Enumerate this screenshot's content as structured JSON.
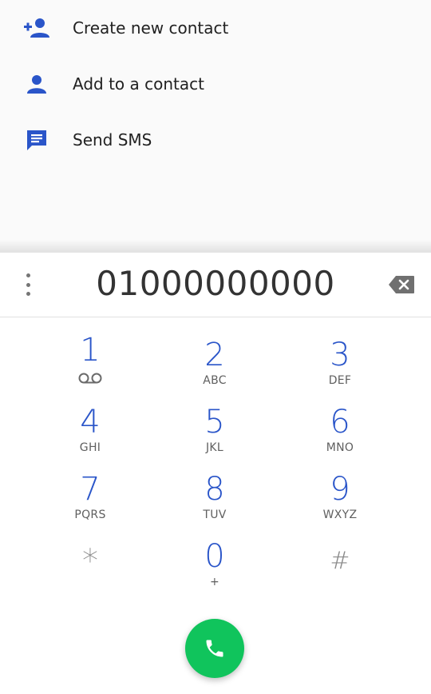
{
  "suggestions": [
    {
      "label": "Create new contact",
      "icon": "person-add-icon"
    },
    {
      "label": "Add to a contact",
      "icon": "person-icon"
    },
    {
      "label": "Send SMS",
      "icon": "message-icon"
    }
  ],
  "dialer": {
    "number": "01000000000",
    "keys": [
      {
        "digit": "1",
        "letters": "",
        "voicemail": true
      },
      {
        "digit": "2",
        "letters": "ABC"
      },
      {
        "digit": "3",
        "letters": "DEF"
      },
      {
        "digit": "4",
        "letters": "GHI"
      },
      {
        "digit": "5",
        "letters": "JKL"
      },
      {
        "digit": "6",
        "letters": "MNO"
      },
      {
        "digit": "7",
        "letters": "PQRS"
      },
      {
        "digit": "8",
        "letters": "TUV"
      },
      {
        "digit": "9",
        "letters": "WXYZ"
      },
      {
        "digit": "*",
        "letters": ""
      },
      {
        "digit": "0",
        "letters": "+"
      },
      {
        "digit": "#",
        "letters": ""
      }
    ]
  },
  "colors": {
    "accent": "#2a55c9",
    "call_button": "#10c45c",
    "icon_blue": "#2a55c9"
  }
}
